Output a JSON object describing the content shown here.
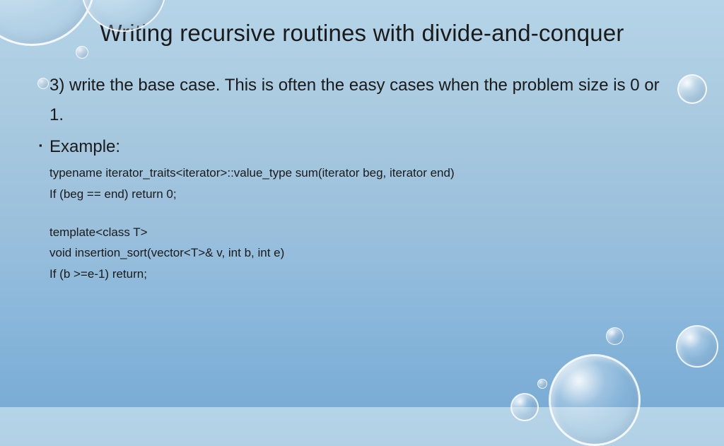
{
  "title": "Writing recursive routines with divide-and-conquer",
  "step": "3) write the base case. This is often the easy cases when the problem size is 0 or 1.",
  "example_label": "Example:",
  "code": {
    "l1": "typename iterator_traits<iterator>::value_type sum(iterator beg, iterator end)",
    "l2": "If (beg == end) return 0;",
    "l3": "template<class T>",
    "l4": "void insertion_sort(vector<T>& v, int b, int e)",
    "l5": "If (b >=e-1) return;"
  }
}
